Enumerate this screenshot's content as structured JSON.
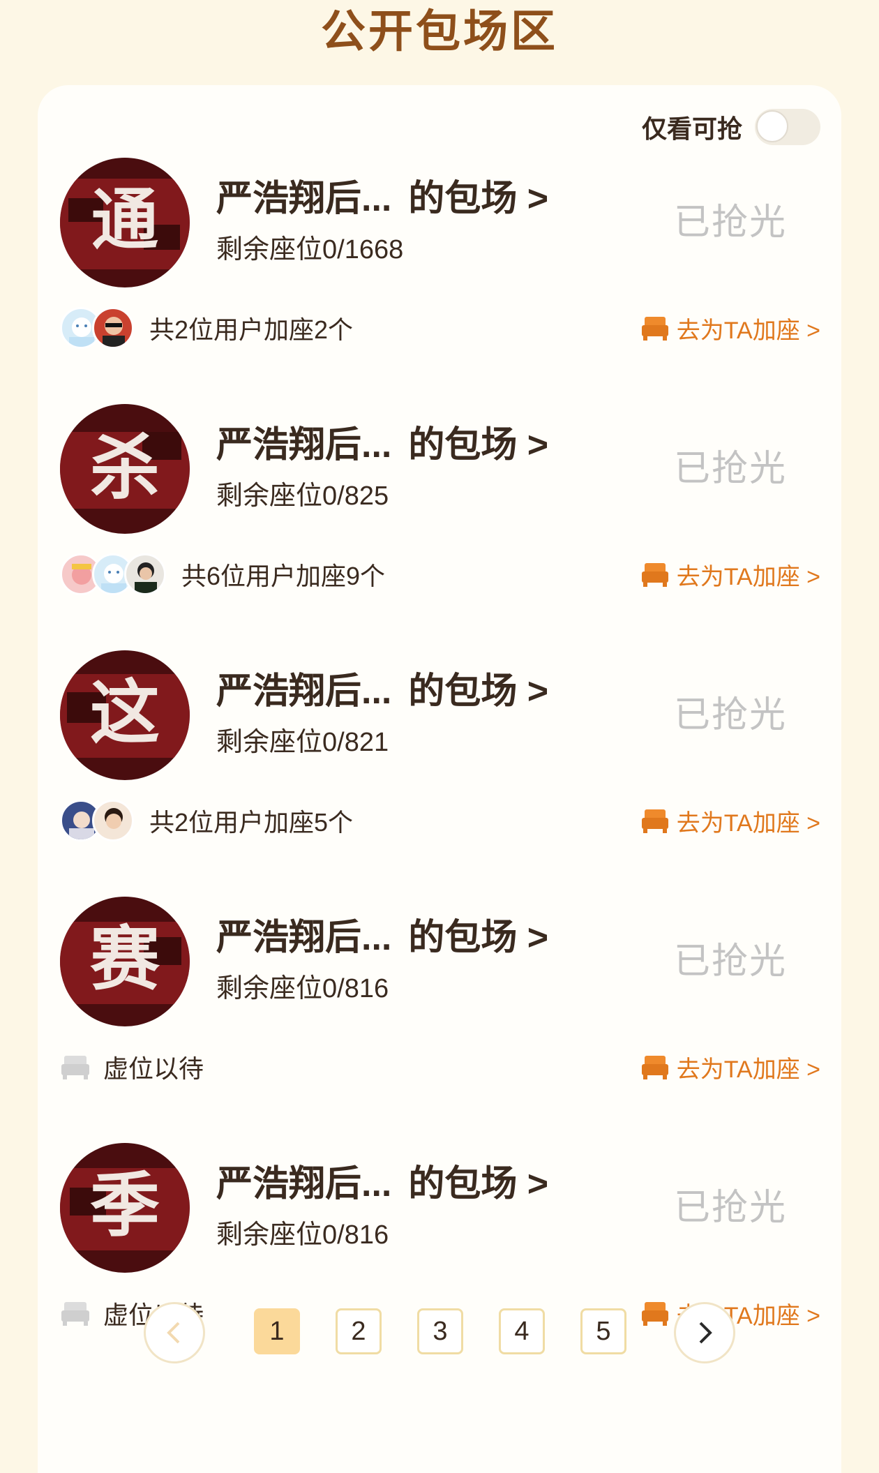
{
  "header": {
    "title": "公开包场区"
  },
  "filter": {
    "label": "仅看可抢",
    "enabled": false
  },
  "items": [
    {
      "title": "严浩翔后...",
      "suffix": "的包场 >",
      "seats": "剩余座位0/1668",
      "status": "已抢光",
      "avatar_char": "通",
      "join_text": "共2位用户加座2个",
      "action": "去为TA加座 >"
    },
    {
      "title": "严浩翔后...",
      "suffix": "的包场 >",
      "seats": "剩余座位0/825",
      "status": "已抢光",
      "avatar_char": "杀",
      "join_text": "共6位用户加座9个",
      "action": "去为TA加座 >"
    },
    {
      "title": "严浩翔后...",
      "suffix": "的包场 >",
      "seats": "剩余座位0/821",
      "status": "已抢光",
      "avatar_char": "这",
      "join_text": "共2位用户加座5个",
      "action": "去为TA加座 >"
    },
    {
      "title": "严浩翔后...",
      "suffix": "的包场 >",
      "seats": "剩余座位0/816",
      "status": "已抢光",
      "avatar_char": "赛",
      "empty_text": "虚位以待",
      "action": "去为TA加座 >"
    },
    {
      "title": "严浩翔后...",
      "suffix": "的包场 >",
      "seats": "剩余座位0/816",
      "status": "已抢光",
      "avatar_char": "季",
      "empty_text": "虚位以待",
      "action": "去为TA加座 >"
    }
  ],
  "pagination": {
    "pages": [
      "1",
      "2",
      "3",
      "4",
      "5"
    ],
    "current": "1"
  },
  "colors": {
    "accent": "#e0781d",
    "title": "#8e4f1b",
    "sold": "#c3c3c3",
    "background": "#fdf7e6"
  }
}
